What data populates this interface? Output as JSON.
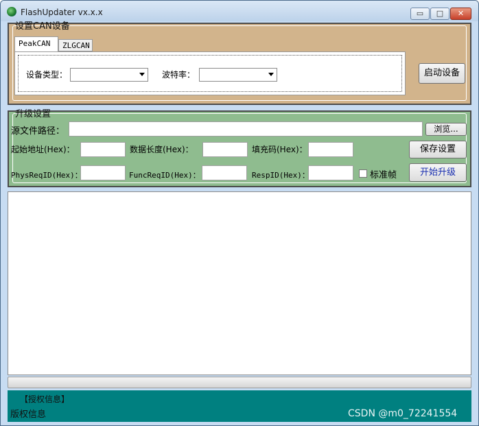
{
  "window": {
    "title": "FlashUpdater vx.x.x"
  },
  "window_buttons": {
    "minimize": "▭",
    "maximize": "□",
    "close": "✕"
  },
  "device_group": {
    "legend": "设置CAN设备",
    "tabs": [
      {
        "label": "PeakCAN",
        "selected": true
      },
      {
        "label": "ZLGCAN",
        "selected": false
      }
    ],
    "device_type_label": "设备类型：",
    "device_type_value": "",
    "baud_label": "波特率：",
    "baud_value": "",
    "start_device_button": "启动设备"
  },
  "upgrade_group": {
    "legend": "升级设置",
    "source_path_label": "源文件路径：",
    "source_path_value": "",
    "browse_button": "浏览...",
    "start_addr_label": "起始地址(Hex)：",
    "start_addr_value": "",
    "data_len_label": "数据长度(Hex)：",
    "data_len_value": "",
    "fill_code_label": "填充码(Hex)：",
    "fill_code_value": "",
    "save_button": "保存设置",
    "phys_req_label": "PhysReqID(Hex)：",
    "phys_req_value": "",
    "func_req_label": "FuncReqID(Hex)：",
    "func_req_value": "",
    "resp_label": "RespID(Hex)：",
    "resp_value": "",
    "std_frame_label": "标准帧",
    "std_frame_checked": false,
    "start_upgrade_button": "开始升级"
  },
  "progress": {
    "value": 0
  },
  "footer": {
    "title": "【授权信息】",
    "text": "版权信息",
    "watermark": "CSDN @m0_72241554"
  }
}
